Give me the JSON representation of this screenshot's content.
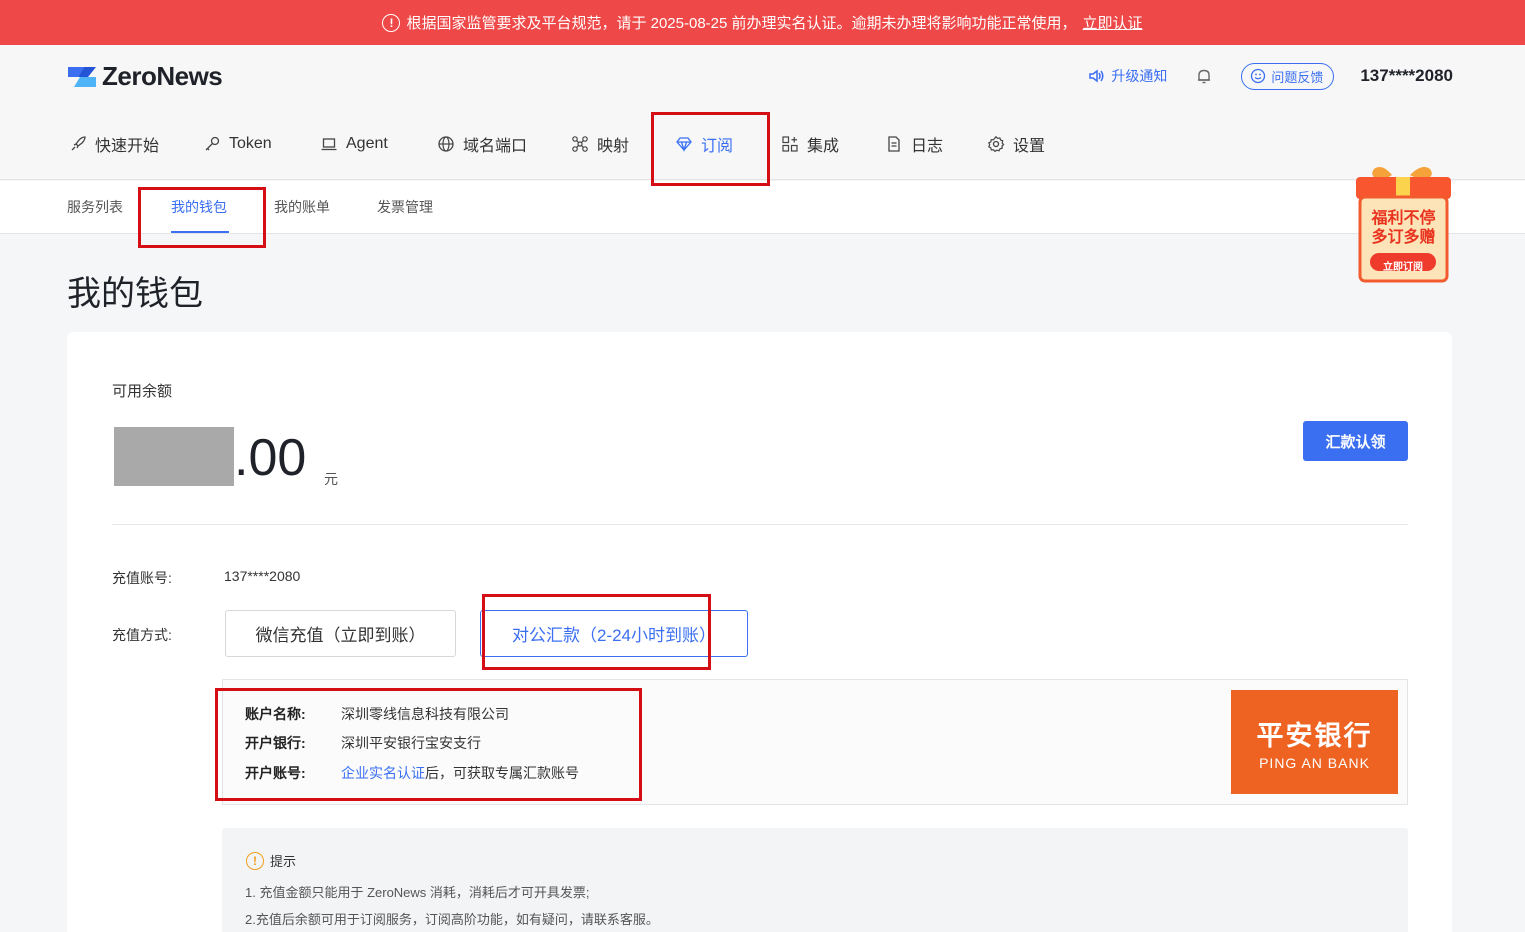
{
  "banner": {
    "text": "根据国家监管要求及平台规范，请于 2025-08-25 前办理实名认证。逾期未办理将影响功能正常使用，",
    "link": "立即认证"
  },
  "header": {
    "brand": "ZeroNews",
    "upgrade_notice": "升级通知",
    "feedback": "问题反馈",
    "user": "137****2080"
  },
  "main_nav": [
    {
      "label": "快速开始",
      "icon": "rocket-icon"
    },
    {
      "label": "Token",
      "icon": "key-icon"
    },
    {
      "label": "Agent",
      "icon": "laptop-icon"
    },
    {
      "label": "域名端口",
      "icon": "globe-icon"
    },
    {
      "label": "映射",
      "icon": "mapping-icon"
    },
    {
      "label": "订阅",
      "icon": "diamond-icon",
      "active": true
    },
    {
      "label": "集成",
      "icon": "apps-icon"
    },
    {
      "label": "日志",
      "icon": "document-icon"
    },
    {
      "label": "设置",
      "icon": "gear-icon"
    }
  ],
  "sub_nav": [
    {
      "label": "服务列表"
    },
    {
      "label": "我的钱包",
      "active": true
    },
    {
      "label": "我的账单"
    },
    {
      "label": "发票管理"
    }
  ],
  "promo": {
    "line1": "福利不停",
    "line2": "多订多赠",
    "button": "立即订阅"
  },
  "page_title": "我的钱包",
  "wallet": {
    "balance_label": "可用余额",
    "balance_value": ".00",
    "unit": "元",
    "claim_button": "汇款认领",
    "account_label": "充值账号:",
    "account_value": "137****2080",
    "method_label": "充值方式:",
    "method_wechat": "微信充值（立即到账）",
    "method_transfer": "对公汇款（2-24小时到账）"
  },
  "bank": {
    "name_label": "账户名称:",
    "name_value": "深圳零线信息科技有限公司",
    "bank_label": "开户银行:",
    "bank_value": "深圳平安银行宝安支行",
    "number_label": "开户账号:",
    "number_link": "企业实名认证",
    "number_suffix": "后，可获取专属汇款账号",
    "logo_cn": "平安银行",
    "logo_en": "PING AN BANK"
  },
  "tips": {
    "title": "提示",
    "line1": "1. 充值金额只能用于 ZeroNews 消耗，消耗后才可开具发票;",
    "line2": "2.充值后余额可用于订阅服务，订阅高阶功能，如有疑问，请联系客服。"
  },
  "colors": {
    "accent": "#3a6ff2",
    "banner": "#ef4848",
    "highlight": "#d40e14",
    "bank_orange": "#ee6322"
  }
}
